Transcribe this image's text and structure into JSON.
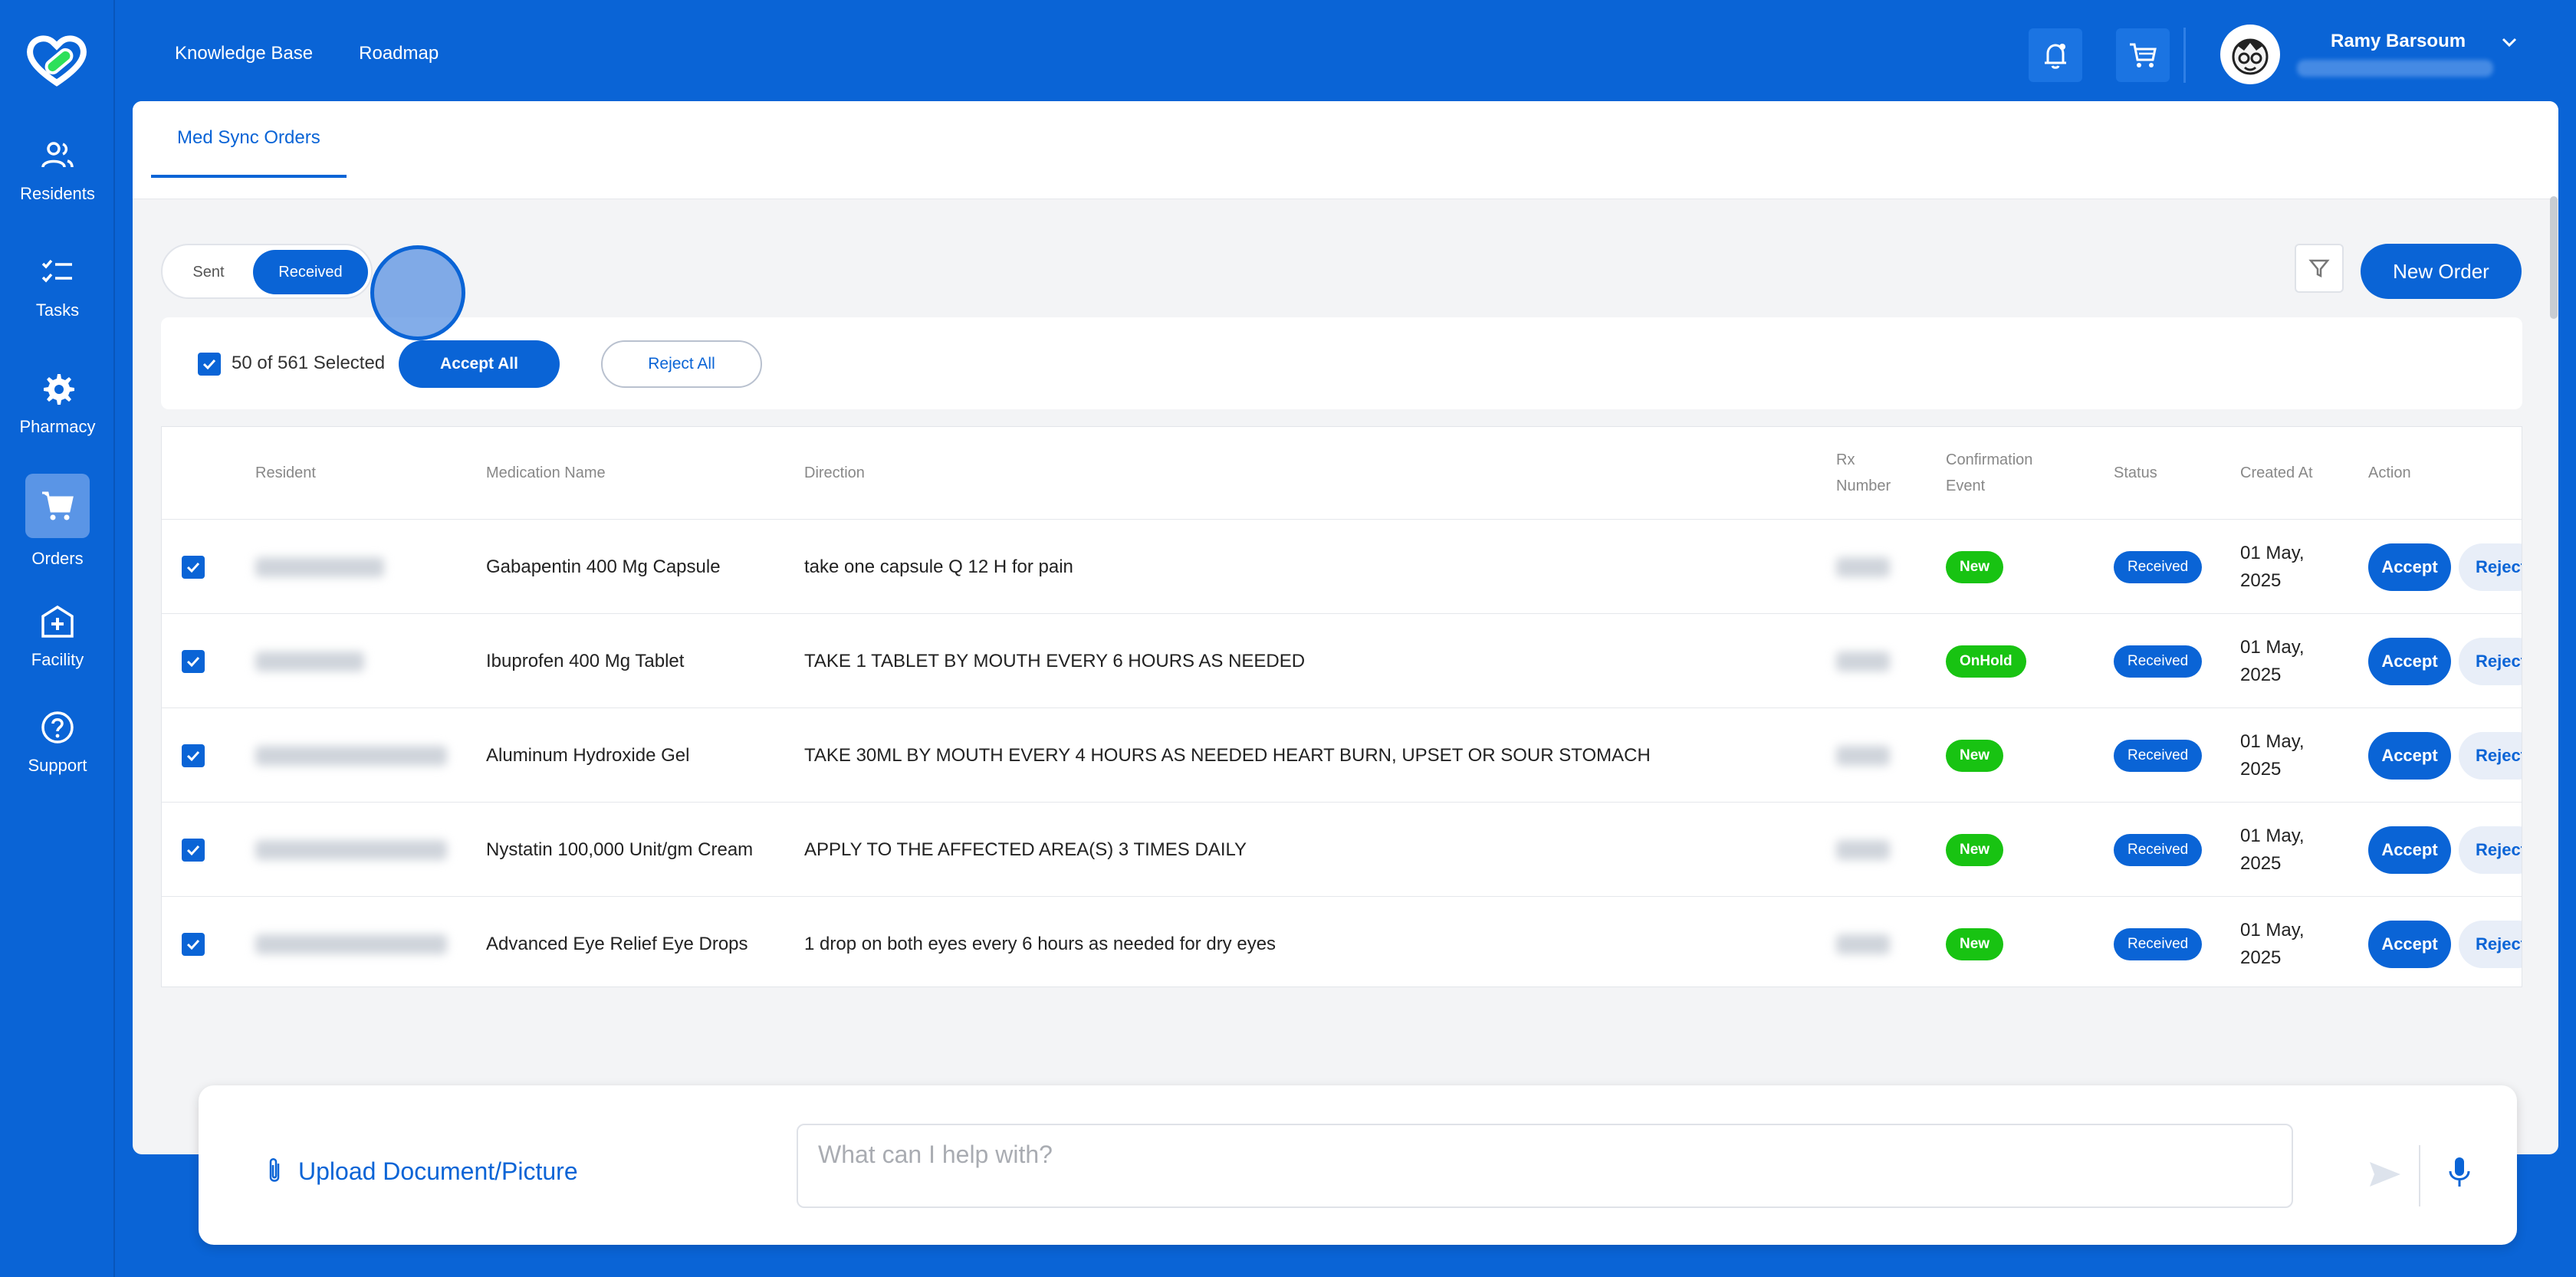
{
  "sidebar": {
    "items": [
      {
        "label": "Residents",
        "icon": "users-icon"
      },
      {
        "label": "Tasks",
        "icon": "checklist-icon"
      },
      {
        "label": "Pharmacy",
        "icon": "gear-icon"
      },
      {
        "label": "Orders",
        "icon": "cart-icon",
        "active": true
      },
      {
        "label": "Facility",
        "icon": "hospital-icon"
      },
      {
        "label": "Support",
        "icon": "help-icon"
      }
    ]
  },
  "topnav": {
    "knowledge_base": "Knowledge Base",
    "roadmap": "Roadmap"
  },
  "user": {
    "name": "Ramy Barsoum"
  },
  "tabs": {
    "active": "Med Sync Orders"
  },
  "toggle": {
    "sent": "Sent",
    "received": "Received"
  },
  "toolbar": {
    "new_order": "New Order"
  },
  "selection": {
    "text": "50 of 561 Selected",
    "accept_all": "Accept All",
    "reject_all": "Reject All"
  },
  "table": {
    "headers": {
      "resident": "Resident",
      "medication": "Medication Name",
      "direction": "Direction",
      "rx_line1": "Rx",
      "rx_line2": "Number",
      "conf_line1": "Confirmation",
      "conf_line2": "Event",
      "status": "Status",
      "created": "Created At",
      "action": "Action"
    },
    "rows": [
      {
        "medication": "Gabapentin 400 Mg Capsule",
        "direction": "take one capsule Q 12 H for pain",
        "event": "New",
        "status": "Received",
        "date1": "01 May,",
        "date2": "2025",
        "accept": "Accept",
        "reject": "Reject"
      },
      {
        "medication": "Ibuprofen 400 Mg Tablet",
        "direction": "TAKE 1 TABLET BY MOUTH EVERY 6 HOURS AS NEEDED",
        "event": "OnHold",
        "status": "Received",
        "date1": "01 May,",
        "date2": "2025",
        "accept": "Accept",
        "reject": "Reject"
      },
      {
        "medication": "Aluminum Hydroxide Gel",
        "direction": "TAKE 30ML BY MOUTH EVERY 4 HOURS AS NEEDED HEART BURN, UPSET OR SOUR STOMACH",
        "event": "New",
        "status": "Received",
        "date1": "01 May,",
        "date2": "2025",
        "accept": "Accept",
        "reject": "Reject"
      },
      {
        "medication": "Nystatin 100,000 Unit/gm Cream",
        "direction": "APPLY TO THE AFFECTED AREA(S) 3 TIMES DAILY",
        "event": "New",
        "status": "Received",
        "date1": "01 May,",
        "date2": "2025",
        "accept": "Accept",
        "reject": "Reject"
      },
      {
        "medication": "Advanced Eye Relief Eye Drops",
        "direction": "1 drop on both eyes every 6 hours as needed for dry eyes",
        "event": "New",
        "status": "Received",
        "date1": "01 May,",
        "date2": "2025",
        "accept": "Accept",
        "reject": "Reject"
      }
    ]
  },
  "chat": {
    "upload": "Upload Document/Picture",
    "placeholder": "What can I help with?"
  },
  "colors": {
    "brand": "#0a64d6",
    "green_badge": "#18c312"
  }
}
